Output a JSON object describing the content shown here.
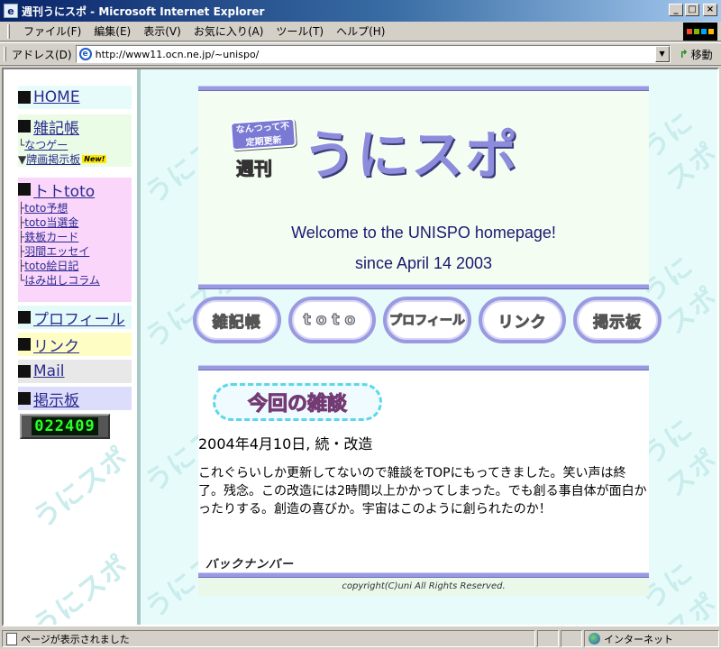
{
  "window": {
    "title": "週刊うにスポ - Microsoft Internet Explorer",
    "app_icon": "e"
  },
  "menu": [
    "ファイル(F)",
    "編集(E)",
    "表示(V)",
    "お気に入り(A)",
    "ツール(T)",
    "ヘルプ(H)"
  ],
  "address": {
    "label": "アドレス(D)",
    "url": "http://www11.ocn.ne.jp/~unispo/",
    "go_label": "移動"
  },
  "sidebar": {
    "home": "HOME",
    "zakki": "雑記帳",
    "zakki_sub1": "なつゲー",
    "zakki_sub2": "牌画掲示板",
    "new_badge": "New!",
    "toto": "トトtoto",
    "toto_items": [
      "toto予想",
      "toto当選金",
      "鉄板カード",
      "羽間エッセイ",
      "toto絵日記",
      "はみ出しコラム"
    ],
    "profile": "プロフィール",
    "link": "リンク",
    "mail": "Mail",
    "bbs": "掲示板",
    "counter": "022409"
  },
  "main": {
    "logo_small": "なんつって不定期更新",
    "logo_shukan": "週刊",
    "logo_main": "うにスポ",
    "welcome": "Welcome to the UNISPO homepage!",
    "since": "since April 14 2003",
    "nav_buttons": [
      "雑記帳",
      "toto",
      "プロフィール",
      "リンク",
      "掲示板"
    ],
    "heading": "今回の雑談",
    "date": "2004年4月10日, 続・改造",
    "body": "これぐらいしか更新してないので雑談をTOPにもってきました。笑い声は終了。残念。この改造には2時間以上かかってしまった。でも創る事自体が面白かったりする。創造の喜びか。宇宙はこのように創られたのか！",
    "backnumber": "バックナンバー",
    "copyright": "copyright(C)uni All Rights Reserved."
  },
  "watermark": "うにスポ",
  "status": {
    "text": "ページが表示されました",
    "zone": "インターネット"
  },
  "colors": {
    "titlebar": "#0a246a",
    "accent": "#9a9ae0",
    "background": "#e8fbfb",
    "counter_digits": "#2bff2b"
  }
}
